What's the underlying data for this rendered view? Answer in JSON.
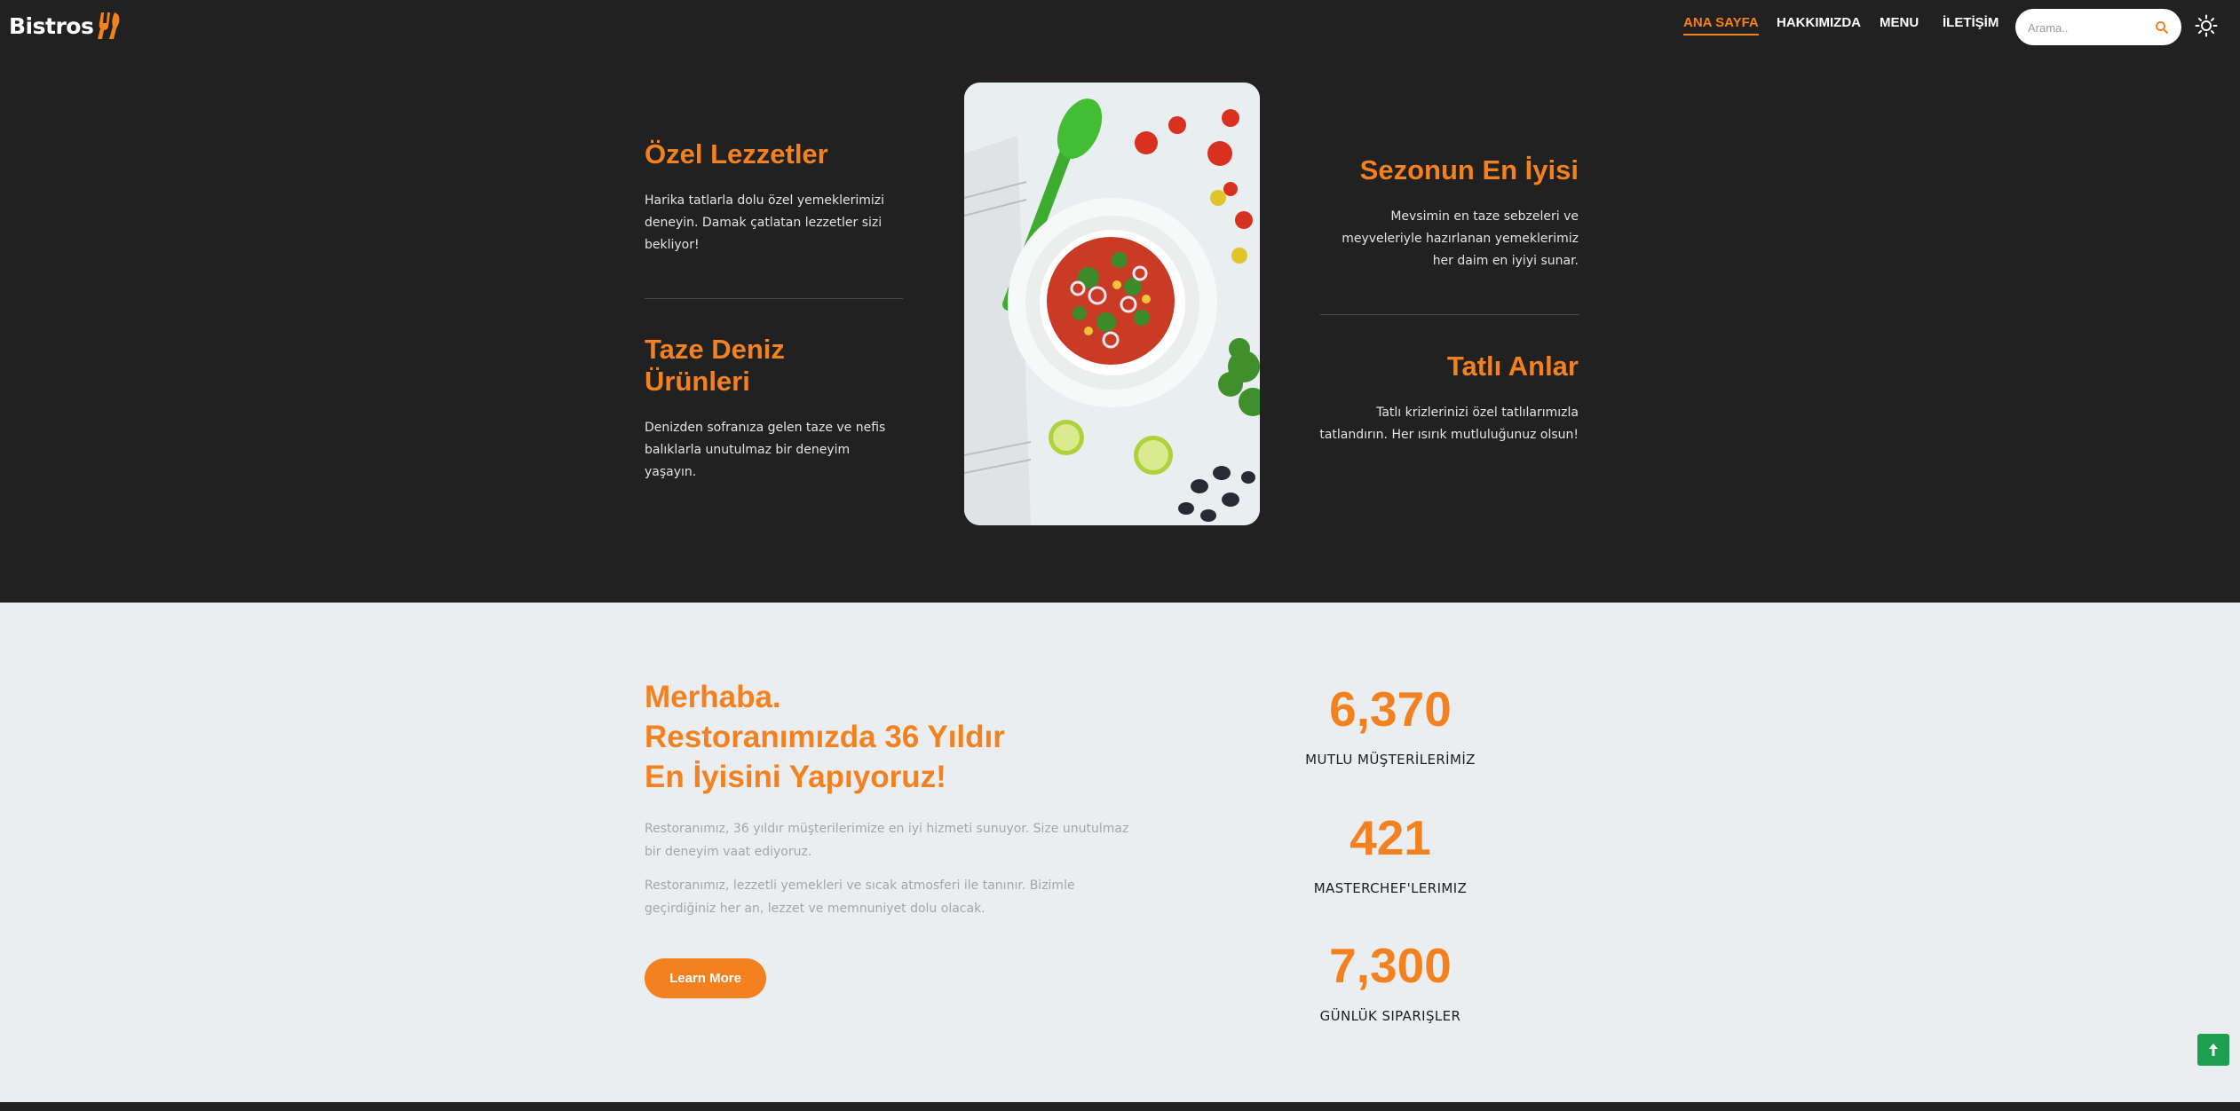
{
  "brand": {
    "name": "Bistros",
    "logo_icon": "fork-knife-icon",
    "accent": "#f48120"
  },
  "nav": {
    "items": [
      {
        "label": "ANA SAYFA",
        "active": true
      },
      {
        "label": "HAKKIMIZDA",
        "active": false
      },
      {
        "label": "MENU",
        "active": false
      },
      {
        "label": "İLETİŞİM",
        "active": false
      }
    ]
  },
  "search": {
    "placeholder": "Arama..",
    "icon": "search-icon"
  },
  "theme_toggle": {
    "icon": "sun-icon"
  },
  "features": {
    "left": [
      {
        "title": "Özel Lezzetler",
        "text": "Harika tatlarla dolu özel yemeklerimizi deneyin. Damak çatlatan lezzetler sizi bekliyor!"
      },
      {
        "title": "Taze Deniz Ürünleri",
        "text": "Denizden sofranıza gelen taze ve nefis balıklarla unutulmaz bir deneyim yaşayın."
      }
    ],
    "right": [
      {
        "title": "Sezonun En İyisi",
        "text": "Mevsimin en taze sebzeleri ve meyveleriyle hazırlanan yemeklerimiz her daim en iyiyi sunar."
      },
      {
        "title": "Tatlı Anlar",
        "text": "Tatlı krizlerinizi özel tatlılarımızla tatlandırın. Her ısırık mutluluğunuz olsun!"
      }
    ],
    "image": "salad-bowl-photo"
  },
  "about": {
    "title_lines": [
      "Merhaba.",
      "Restoranımızda 36 Yıldır",
      "En İyisini Yapıyoruz!"
    ],
    "paragraphs": [
      "Restoranımız, 36 yıldır müşterilerimize en iyi hizmeti sunuyor. Size unutulmaz bir deneyim vaat ediyoruz.",
      "Restoranımız, lezzetli yemekleri ve sıcak atmosferi ile tanınır. Bizimle geçirdiğiniz her an, lezzet ve memnuniyet dolu olacak."
    ],
    "button_label": "Learn More"
  },
  "stats": [
    {
      "value": "6,370",
      "label": "MUTLU MÜŞTERİLERİMİZ"
    },
    {
      "value": "421",
      "label": "MASTERCHEF'LERIMIZ"
    },
    {
      "value": "7,300",
      "label": "GÜNLÜK SIPARIŞLER"
    }
  ],
  "back_to_top": {
    "icon": "arrow-up-icon",
    "color": "#1e9e4f"
  }
}
